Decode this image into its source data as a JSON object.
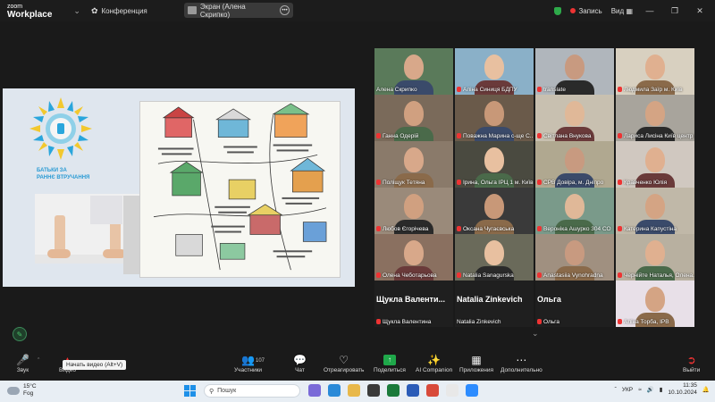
{
  "titlebar": {
    "logo_line1": "zoom",
    "logo_line2": "Workplace",
    "conference_label": "Конференция",
    "share_pill_label": "Экран (Алена Скрипко)",
    "record_label": "Запись",
    "view_label": "Вид"
  },
  "shared_screen": {
    "brand_line1": "БАТЬКИ ЗА",
    "brand_line2": "РАННЄ ВТРУЧАННЯ"
  },
  "gallery": {
    "tiles": [
      {
        "name": "Алена Скрипко",
        "muted": false,
        "active": true
      },
      {
        "name": "Аліна Синиця БДПУ",
        "muted": true
      },
      {
        "name": "translate",
        "muted": true
      },
      {
        "name": "Людмила Заїр м. Київ",
        "muted": true
      },
      {
        "name": "Ганна Одерій",
        "muted": true
      },
      {
        "name": "Поважна Марина с-ще С...",
        "muted": true
      },
      {
        "name": "Світлана Внукова",
        "muted": true
      },
      {
        "name": "Лариса Лисіна Київ центр р...",
        "muted": true
      },
      {
        "name": "Поліщук Тетяна",
        "muted": true
      },
      {
        "name": "Ірина, Ольга ІРЦ 1 м. Київ",
        "muted": true
      },
      {
        "name": "СРВ Довіра, м. Дніпро",
        "muted": true
      },
      {
        "name": "Кравченко Юлія",
        "muted": true
      },
      {
        "name": "Любов Єгорічева",
        "muted": true
      },
      {
        "name": "Оксана Чугаєвська",
        "muted": true
      },
      {
        "name": "Вероніка Ашурко 304 СО",
        "muted": true
      },
      {
        "name": "Катерина Капустіна",
        "muted": true
      },
      {
        "name": "Олена Чеботарьова",
        "muted": true
      },
      {
        "name": "Natalia Sanagurska",
        "muted": true
      },
      {
        "name": "Anastasiia Vynohradna",
        "muted": true
      },
      {
        "name": "Чернійте Наталья, Олена...",
        "muted": true
      },
      {
        "name": "Щукла Валентина",
        "muted": true,
        "big": "Щукла Валенти..."
      },
      {
        "name": "Natalia Zinkevich",
        "muted": false,
        "big": "Natalia Zinkevich"
      },
      {
        "name": "Ольга",
        "muted": true,
        "big": "Ольга"
      },
      {
        "name": "Аліна Торба, ІРВ",
        "muted": true
      }
    ]
  },
  "toolbar": {
    "audio": "Звук",
    "video": "Видео",
    "video_tooltip": "Начать видео (Alt+V)",
    "participants": "Участники",
    "participants_count": "107",
    "chat": "Чат",
    "react": "Отреагировать",
    "share": "Поделиться",
    "ai": "AI Companion",
    "apps": "Приложения",
    "more": "Дополнительно",
    "leave": "Выйти"
  },
  "taskbar": {
    "temp": "15°C",
    "weather": "Fog",
    "search_placeholder": "Пошук",
    "lang": "УКР",
    "time": "11:35",
    "date": "10.10.2024"
  },
  "colors": {
    "active_outline": "#2ecc71",
    "mic_muted": "#e33333",
    "share_green": "#1fa84a",
    "record_red": "#e33333"
  }
}
